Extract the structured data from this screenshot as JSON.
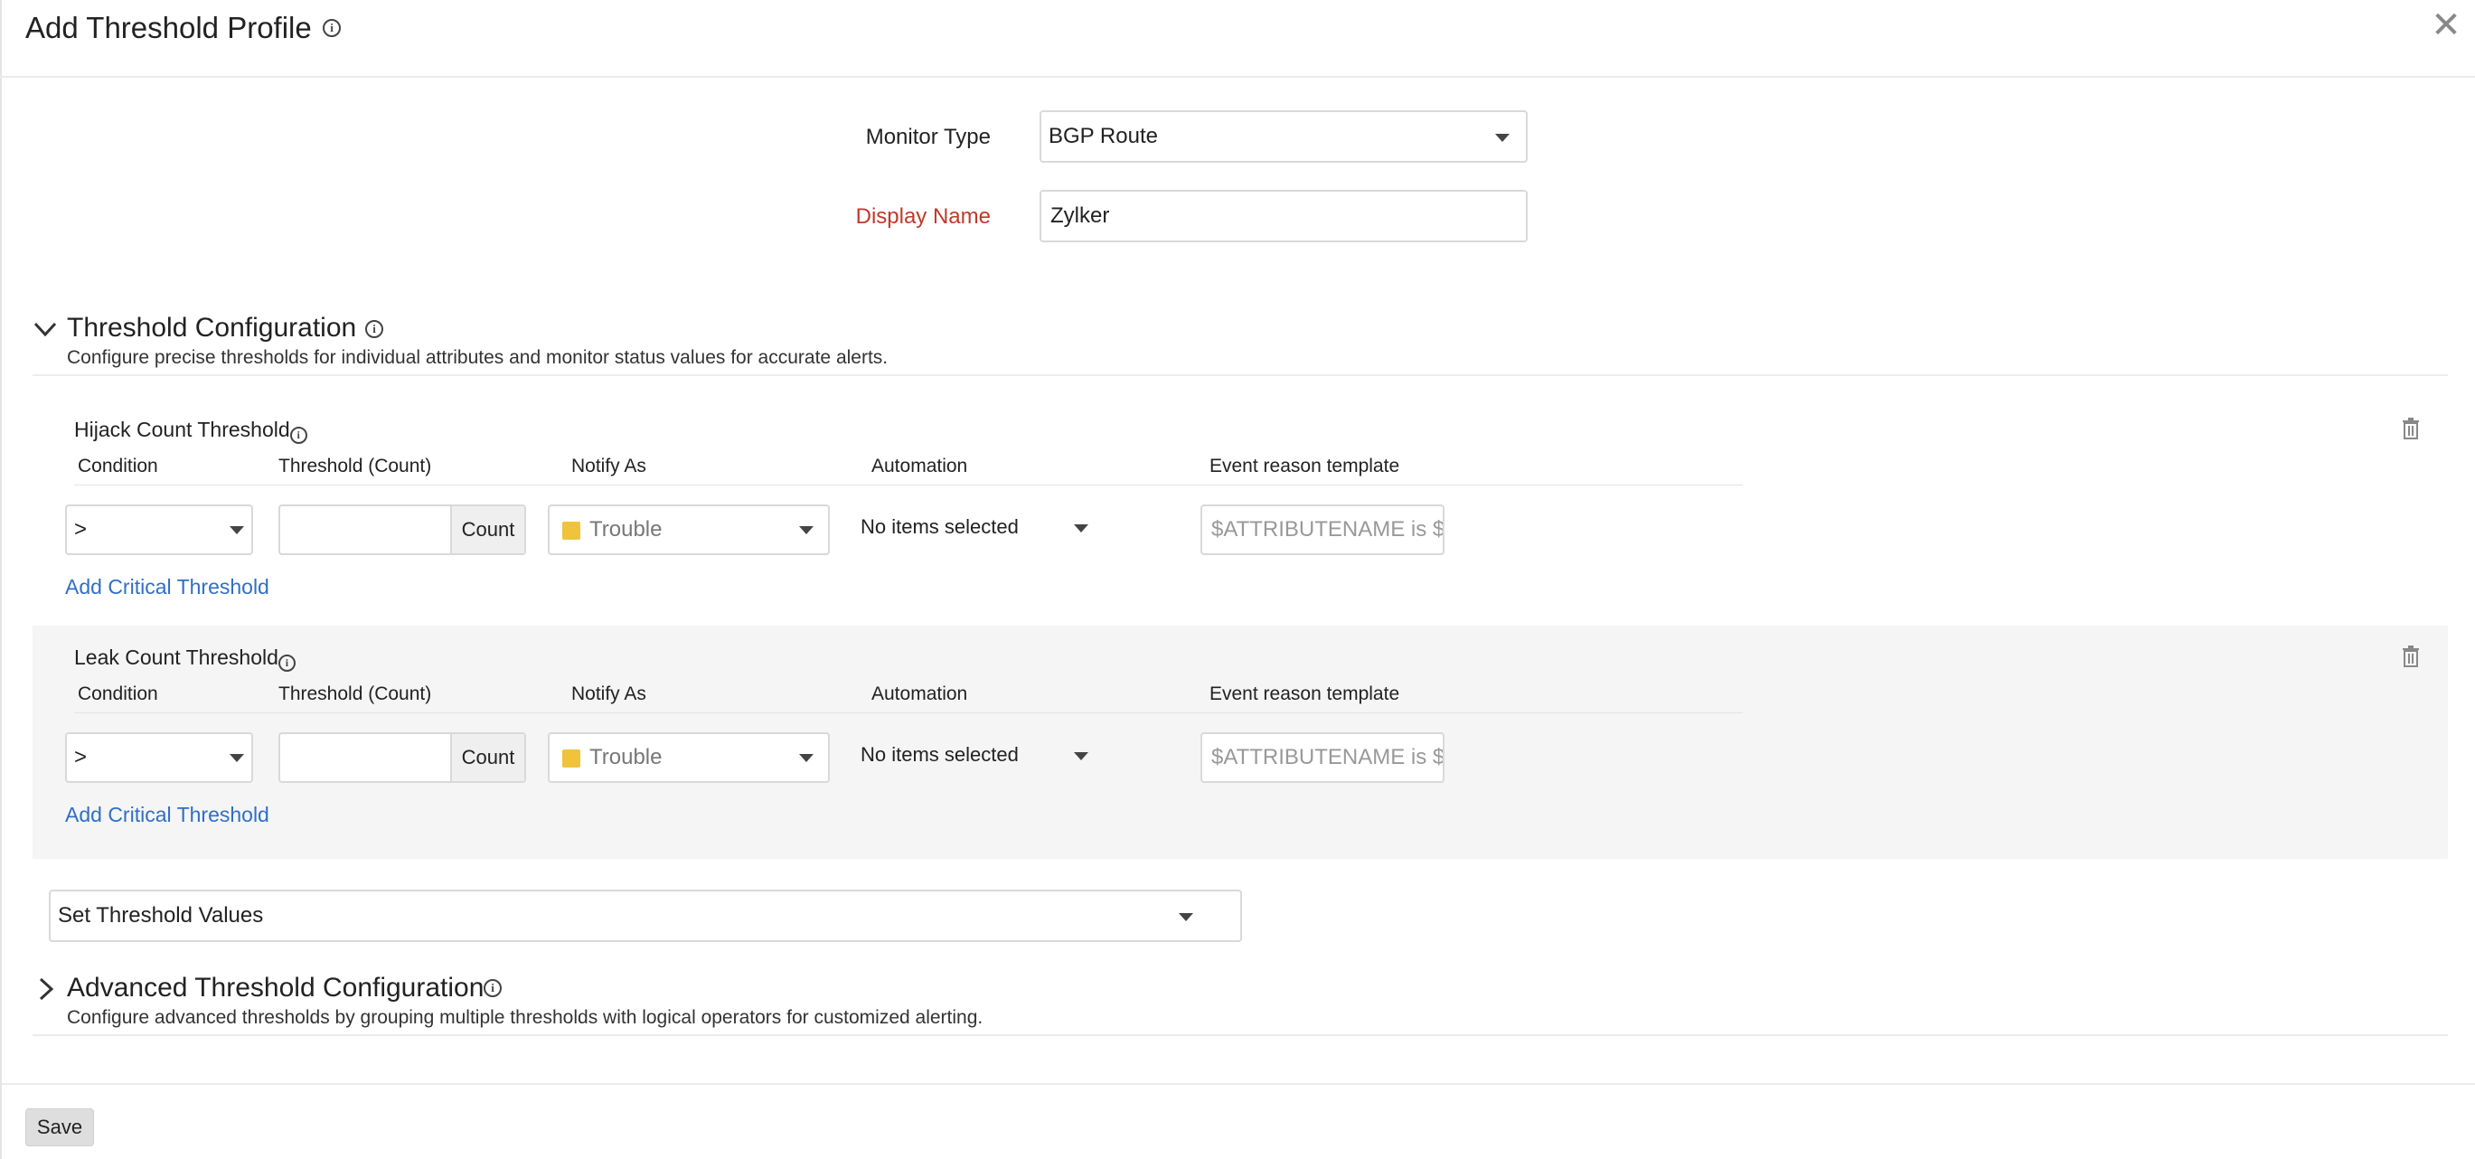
{
  "dialog": {
    "title": "Add Threshold Profile",
    "save_label": "Save"
  },
  "form": {
    "monitor_type_label": "Monitor Type",
    "monitor_type_value": "BGP Route",
    "display_name_label": "Display Name",
    "display_name_value": "Zylker"
  },
  "threshold_config": {
    "title": "Threshold Configuration",
    "description": "Configure precise thresholds for individual attributes and monitor status values for accurate alerts.",
    "columns": {
      "condition": "Condition",
      "threshold": "Threshold (Count)",
      "notify": "Notify As",
      "automation": "Automation",
      "event": "Event reason template"
    },
    "groups": [
      {
        "title": "Hijack Count Threshold",
        "condition": ">",
        "threshold_value": "",
        "unit": "Count",
        "notify_as": "Trouble",
        "automation": "No items selected",
        "event_placeholder": "$ATTRIBUTENAME is $$",
        "add_link": "Add Critical Threshold"
      },
      {
        "title": "Leak Count Threshold",
        "condition": ">",
        "threshold_value": "",
        "unit": "Count",
        "notify_as": "Trouble",
        "automation": "No items selected",
        "event_placeholder": "$ATTRIBUTENAME is $$",
        "add_link": "Add Critical Threshold"
      }
    ],
    "set_values_label": "Set Threshold Values"
  },
  "advanced_config": {
    "title": "Advanced Threshold Configuration",
    "description": "Configure advanced thresholds by grouping multiple thresholds with logical operators for customized alerting."
  },
  "colors": {
    "required_label": "#c0392b",
    "link": "#2f6fc6",
    "trouble_swatch": "#f0c33c"
  }
}
